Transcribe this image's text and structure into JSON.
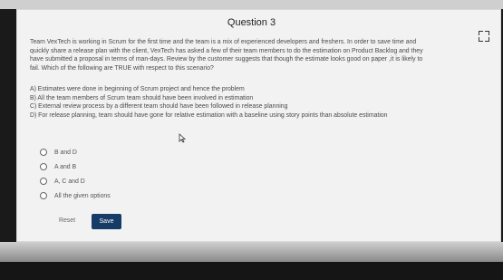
{
  "question": {
    "title": "Question 3",
    "stem_lines": [
      "Team VexTech is working in Scrum for the first time and the team is a mix of experienced developers and freshers. In order to save time and",
      "quickly share a release plan with the client, VexTech has asked a few of their team members to do the estimation on Product Backlog and they",
      "have submitted a proposal in terms of man-days. Review by the customer suggests that though the estimate looks good on paper ,it is likely to",
      "fail. Which of the following are TRUE with respect to this scenario?"
    ],
    "statements": [
      "A) Estimates were done in beginning of Scrum project and hence the problem",
      "B) All the team members of Scrum team should have been involved in estimation",
      "C) External review process by a different team should have been followed in release planning",
      "D) For release planning, team should have gone for relative estimation with a baseline using story points than absolute estimation"
    ],
    "options": [
      {
        "label": "B and D"
      },
      {
        "label": "A and B"
      },
      {
        "label": "A, C and D"
      },
      {
        "label": "All the given options"
      }
    ]
  },
  "actions": {
    "reset_label": "Reset",
    "save_label": "Save"
  },
  "icons": {
    "fullscreen": "fullscreen-icon",
    "cursor": "mouse-cursor-icon"
  },
  "colors": {
    "save_button": "#163b66",
    "card_background": "#f2f2f2"
  }
}
